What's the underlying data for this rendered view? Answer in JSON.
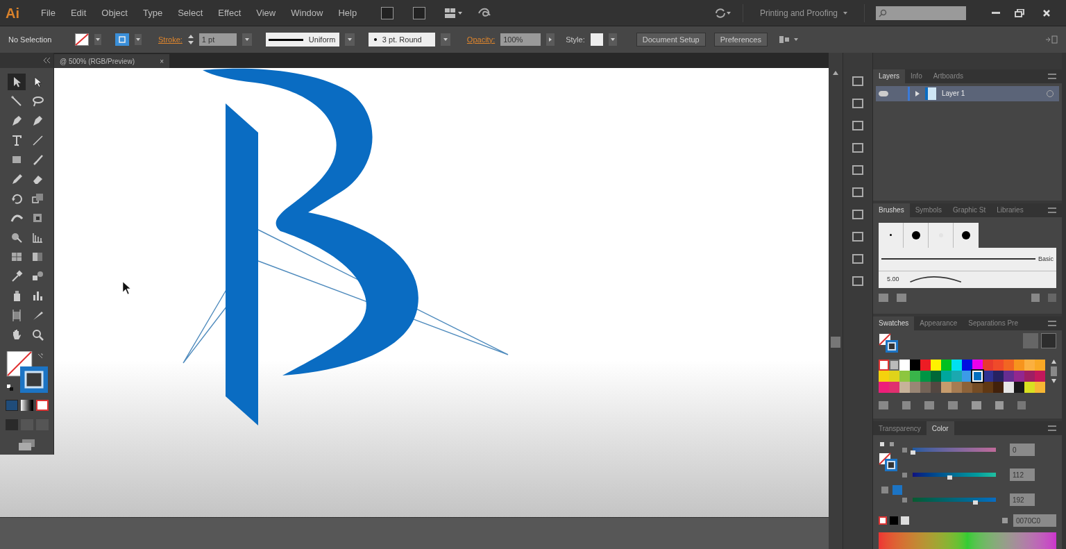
{
  "app_logo": "Ai",
  "menu": [
    "File",
    "Edit",
    "Object",
    "Type",
    "Select",
    "Effect",
    "View",
    "Window",
    "Help"
  ],
  "workspace": "Printing and Proofing",
  "control_bar": {
    "selection": "No Selection",
    "stroke_label": "Stroke:",
    "stroke_weight": "1 pt",
    "profile": "Uniform",
    "brush": "3 pt. Round",
    "opacity_label": "Opacity:",
    "opacity": "100%",
    "style_label": "Style:",
    "buttons": [
      "Document Setup",
      "Preferences"
    ]
  },
  "document_tab": {
    "title": "@ 500% (RGB/Preview)",
    "close": "×"
  },
  "tools": [
    {
      "kind": "selection",
      "selected": true
    },
    {
      "kind": "direct-selection",
      "selected": false
    },
    {
      "kind": "magic-wand",
      "selected": false
    },
    {
      "kind": "lasso",
      "selected": false
    },
    {
      "kind": "pen",
      "selected": false
    },
    {
      "kind": "pen",
      "selected": false
    },
    {
      "kind": "type",
      "selected": false
    },
    {
      "kind": "line",
      "selected": false
    },
    {
      "kind": "rectangle",
      "selected": false
    },
    {
      "kind": "brush",
      "selected": false
    },
    {
      "kind": "pencil",
      "selected": false
    },
    {
      "kind": "eraser",
      "selected": false
    },
    {
      "kind": "rotate",
      "selected": false
    },
    {
      "kind": "scale",
      "selected": false
    },
    {
      "kind": "width",
      "selected": false
    },
    {
      "kind": "transform",
      "selected": false
    },
    {
      "kind": "shape-builder",
      "selected": false
    },
    {
      "kind": "perspective",
      "selected": false
    },
    {
      "kind": "mesh",
      "selected": false
    },
    {
      "kind": "gradient",
      "selected": false
    },
    {
      "kind": "eyedropper",
      "selected": false
    },
    {
      "kind": "blend",
      "selected": false
    },
    {
      "kind": "sprayer",
      "selected": false
    },
    {
      "kind": "graph",
      "selected": false
    },
    {
      "kind": "artboard",
      "selected": false
    },
    {
      "kind": "slice",
      "selected": false
    },
    {
      "kind": "hand",
      "selected": false
    },
    {
      "kind": "zoom",
      "selected": false
    }
  ],
  "layers_panel": {
    "tabs": [
      {
        "label": "Layers",
        "selected": true
      },
      {
        "label": "Info",
        "selected": false
      },
      {
        "label": "Artboards",
        "selected": false
      }
    ],
    "layers": [
      {
        "name": "Layer 1",
        "visible": true,
        "selected": true
      }
    ]
  },
  "brushes_panel": {
    "tabs": [
      {
        "label": "Brushes",
        "selected": true
      },
      {
        "label": "Symbols",
        "selected": false
      },
      {
        "label": "Graphic St",
        "selected": false
      },
      {
        "label": "Libraries",
        "selected": false
      }
    ],
    "brush_name": "Basic",
    "size": "5.00"
  },
  "swatches_panel": {
    "tabs": [
      {
        "label": "Swatches",
        "selected": true
      },
      {
        "label": "Appearance",
        "selected": false
      },
      {
        "label": "Separations Pre",
        "selected": false
      }
    ],
    "swatches": [
      {
        "kind": "none",
        "selected": false
      },
      {
        "kind": "registration",
        "selected": false
      },
      {
        "kind": "color",
        "color": "#ffffff",
        "selected": false
      },
      {
        "kind": "color",
        "color": "#000000",
        "selected": false
      },
      {
        "kind": "color",
        "color": "#ed1c24",
        "selected": false
      },
      {
        "kind": "color",
        "color": "#fff200",
        "selected": false
      },
      {
        "kind": "color",
        "color": "#00c020",
        "selected": false
      },
      {
        "kind": "color",
        "color": "#00e0f0",
        "selected": false
      },
      {
        "kind": "color",
        "color": "#0010e0",
        "selected": false
      },
      {
        "kind": "color",
        "color": "#ec00ec",
        "selected": false
      },
      {
        "kind": "color",
        "color": "#e83a2e",
        "selected": false
      },
      {
        "kind": "color",
        "color": "#f04a2a",
        "selected": false
      },
      {
        "kind": "color",
        "color": "#f26522",
        "selected": false
      },
      {
        "kind": "color",
        "color": "#f7941d",
        "selected": false
      },
      {
        "kind": "color",
        "color": "#fbb040",
        "selected": false
      },
      {
        "kind": "color",
        "color": "#f9a825",
        "selected": false
      },
      {
        "kind": "color",
        "color": "#f5d20d",
        "selected": false
      },
      {
        "kind": "color",
        "color": "#dfd31a",
        "selected": false
      },
      {
        "kind": "color",
        "color": "#8dc63f",
        "selected": false
      },
      {
        "kind": "color",
        "color": "#39b54a",
        "selected": false
      },
      {
        "kind": "color",
        "color": "#009444",
        "selected": false
      },
      {
        "kind": "color",
        "color": "#006838",
        "selected": false
      },
      {
        "kind": "color",
        "color": "#00a79d",
        "selected": false
      },
      {
        "kind": "color",
        "color": "#1ba8b0",
        "selected": false
      },
      {
        "kind": "color",
        "color": "#3b9be8",
        "selected": false
      },
      {
        "kind": "color",
        "color": "#0070c0",
        "selected": true
      },
      {
        "kind": "color",
        "color": "#2e3192",
        "selected": false
      },
      {
        "kind": "color",
        "color": "#262262",
        "selected": false
      },
      {
        "kind": "color",
        "color": "#662d91",
        "selected": false
      },
      {
        "kind": "color",
        "color": "#92278f",
        "selected": false
      },
      {
        "kind": "color",
        "color": "#9e1f63",
        "selected": false
      },
      {
        "kind": "color",
        "color": "#c2185b",
        "selected": false
      },
      {
        "kind": "color",
        "color": "#ed1e79",
        "selected": false
      },
      {
        "kind": "color",
        "color": "#e0306f",
        "selected": false
      },
      {
        "kind": "color",
        "color": "#c7b299",
        "selected": false
      },
      {
        "kind": "color",
        "color": "#998675",
        "selected": false
      },
      {
        "kind": "color",
        "color": "#736357",
        "selected": false
      },
      {
        "kind": "color",
        "color": "#534741",
        "selected": false
      },
      {
        "kind": "color",
        "color": "#c69c6d",
        "selected": false
      },
      {
        "kind": "color",
        "color": "#a67c52",
        "selected": false
      },
      {
        "kind": "color",
        "color": "#8c6239",
        "selected": false
      },
      {
        "kind": "color",
        "color": "#754c24",
        "selected": false
      },
      {
        "kind": "color",
        "color": "#603813",
        "selected": false
      },
      {
        "kind": "color",
        "color": "#42210b",
        "selected": false
      },
      {
        "kind": "color",
        "color": "#e6e6e6",
        "selected": false
      },
      {
        "kind": "color",
        "color": "#1a1a1a",
        "selected": false
      },
      {
        "kind": "color",
        "color": "#d9e021",
        "selected": false
      },
      {
        "kind": "color",
        "color": "#f7b733",
        "selected": false
      }
    ]
  },
  "color_panel": {
    "tabs": [
      {
        "label": "Transparency",
        "selected": false
      },
      {
        "label": "Color",
        "selected": true
      }
    ],
    "channels": [
      {
        "value": "0",
        "level": 0
      },
      {
        "value": "112",
        "level": 0.44
      },
      {
        "value": "192",
        "level": 0.75
      }
    ],
    "hex": "0070C0"
  }
}
